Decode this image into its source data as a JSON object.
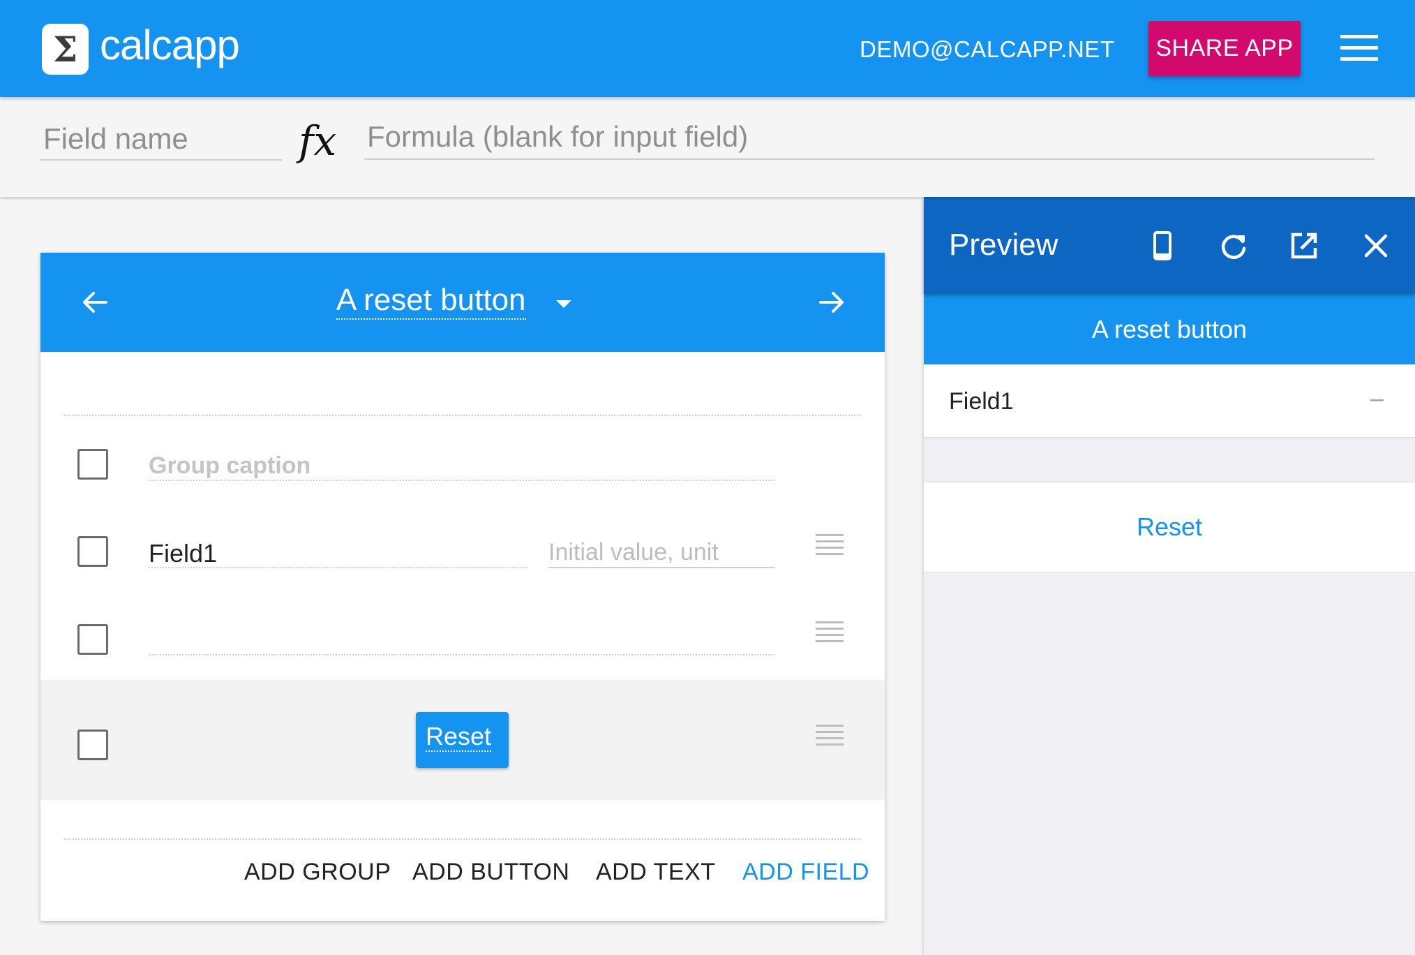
{
  "app": {
    "logo_symbol": "Σ",
    "name": "calcapp",
    "user_email": "DEMO@CALCAPP.NET",
    "share_label": "SHARE APP",
    "menu_icon": "hamburger-icon",
    "brand_color": "#1593f0",
    "share_color": "#d20a6e"
  },
  "formula_bar": {
    "field_name_placeholder": "Field name",
    "field_name_value": "",
    "fx_label": "fx",
    "formula_placeholder": "Formula (blank for input field)",
    "formula_value": ""
  },
  "editor": {
    "screen_title": "A reset button",
    "prev_icon": "arrow-left-icon",
    "next_icon": "arrow-right-icon",
    "dropdown_icon": "caret-down-icon",
    "rows": [
      {
        "type": "group",
        "caption": "Group caption",
        "checked": false
      },
      {
        "type": "field",
        "name": "Field1",
        "value_placeholder": "Initial value, unit",
        "checked": false
      },
      {
        "type": "field",
        "name": "",
        "checked": false
      },
      {
        "type": "button",
        "label": "Reset",
        "checked": false
      }
    ],
    "actions": {
      "add_group": "ADD GROUP",
      "add_button": "ADD BUTTON",
      "add_text": "ADD TEXT",
      "add_field": "ADD FIELD"
    },
    "highlight_color": "#1593f0"
  },
  "preview": {
    "title": "Preview",
    "icons": [
      "phone-icon",
      "refresh-icon",
      "open-external-icon",
      "close-icon"
    ],
    "app_title": "A reset button",
    "field_label": "Field1",
    "field_value": "–",
    "reset_label": "Reset",
    "header_color": "#0d66c2"
  }
}
